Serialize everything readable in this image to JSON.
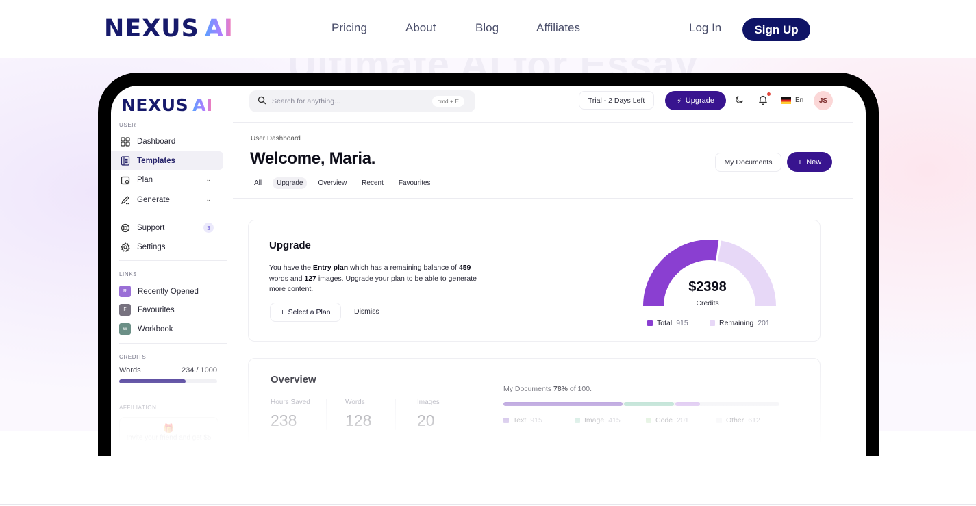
{
  "site": {
    "brand": "NEXUS",
    "brand_ai": "AI",
    "nav": [
      "Pricing",
      "About",
      "Blog",
      "Affiliates"
    ],
    "login": "Log In",
    "signup": "Sign Up",
    "hero_heading_partial": "Ultimate AI for Essay"
  },
  "app": {
    "logo": "NEXUS",
    "logo_ai": "AI",
    "sidebar": {
      "user_section": "USER",
      "items": [
        {
          "label": "Dashboard",
          "icon": "grid-icon"
        },
        {
          "label": "Templates",
          "icon": "document-icon",
          "active": true
        },
        {
          "label": "Plan",
          "icon": "wallet-icon",
          "expandable": true
        },
        {
          "label": "Generate",
          "icon": "pen-icon",
          "expandable": true
        },
        {
          "label": "Support",
          "icon": "lifebuoy-icon",
          "badge": "3"
        },
        {
          "label": "Settings",
          "icon": "gear-icon"
        }
      ],
      "links_section": "LINKS",
      "links": [
        {
          "letter": "R",
          "label": "Recently Opened",
          "color": "#9a6fd6"
        },
        {
          "letter": "F",
          "label": "Favourites",
          "color": "#77727f"
        },
        {
          "letter": "W",
          "label": "Workbook",
          "color": "#6b8f86"
        }
      ],
      "credits_section": "CREDITS",
      "credits": {
        "label": "Words",
        "value": "234 / 1000",
        "used": 234,
        "total": 1000
      },
      "affiliation_section": "AFFILIATION",
      "affiliation_text": "Invite your friend and get $5"
    },
    "topbar": {
      "search_placeholder": "Search for anything...",
      "shortcut": "cmd + E",
      "trial": "Trial - 2 Days Left",
      "upgrade": "Upgrade",
      "language": "En",
      "avatar_initials": "JS"
    },
    "header": {
      "breadcrumb": "User Dashboard",
      "welcome": "Welcome, Maria.",
      "my_documents": "My Documents",
      "new": "New",
      "tabs": [
        "All",
        "Upgrade",
        "Overview",
        "Recent",
        "Favourites"
      ],
      "active_tab": "Upgrade"
    },
    "upgrade_card": {
      "title": "Upgrade",
      "text_1": "You have the ",
      "plan": "Entry plan",
      "text_2": " which has a remaining balance of ",
      "words": "459",
      "text_3": " words and ",
      "images": "127",
      "text_4": " images. Upgrade your plan to be able to generate more content.",
      "select_plan": "Select a Plan",
      "dismiss": "Dismiss",
      "gauge": {
        "amount": "$2398",
        "label": "Credits",
        "total_label": "Total",
        "total_value": "915",
        "remaining_label": "Remaining",
        "remaining_value": "201",
        "total_color": "#8a3fd1",
        "remaining_color": "#e7d8f7"
      }
    },
    "overview_card": {
      "title": "Overview",
      "stats": [
        {
          "label": "Hours Saved",
          "value": "238"
        },
        {
          "label": "Words",
          "value": "128"
        },
        {
          "label": "Images",
          "value": "20"
        }
      ],
      "docs_prefix": "My Documents ",
      "docs_pct": "78%",
      "docs_suffix": " of 100.",
      "segments": [
        {
          "label": "Text",
          "value": "915",
          "color": "#7d4fc0"
        },
        {
          "label": "Image",
          "value": "415",
          "color": "#86c9b0"
        },
        {
          "label": "Code",
          "value": "201",
          "color": "#c39ae6"
        },
        {
          "label": "Other",
          "value": "612",
          "color": "#e9e9ee"
        }
      ]
    }
  },
  "colors": {
    "brand_navy": "#171a6b",
    "signup_bg": "#0f1466",
    "app_primary": "#38148f"
  }
}
